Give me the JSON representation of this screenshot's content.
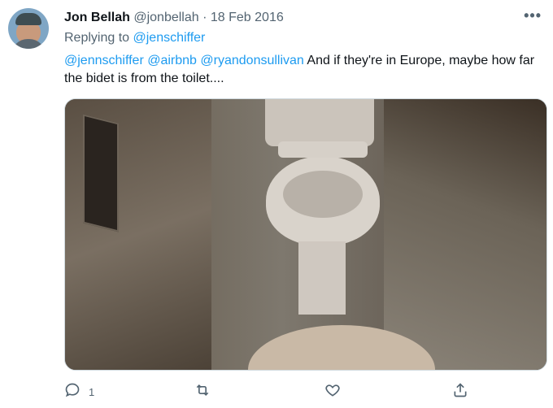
{
  "tweet": {
    "author_name": "Jon Bellah",
    "author_handle": "@jonbellah",
    "separator": "·",
    "date": "18 Feb 2016",
    "replying_prefix": "Replying to",
    "replying_to": "@jenschiffer",
    "mentions": [
      "@jennschiffer",
      "@airbnb",
      "@ryandonsullivan"
    ],
    "body_text": "And if they're in Europe, maybe how far the bidet is from the toilet....",
    "more_icon": "more-horizontal-icon"
  },
  "actions": {
    "reply_count": "1",
    "icons": [
      "reply-icon",
      "retweet-icon",
      "like-icon",
      "share-icon"
    ]
  },
  "colors": {
    "link": "#1d9bf0",
    "secondary": "#536471",
    "text": "#0f1419"
  }
}
